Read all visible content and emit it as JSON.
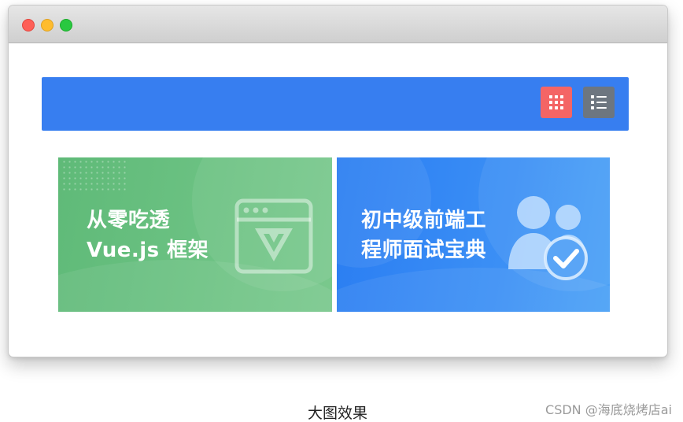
{
  "window": {
    "controls": [
      "close",
      "minimize",
      "zoom"
    ]
  },
  "toolbar": {
    "background": "#377ef0",
    "buttons": [
      {
        "name": "grid-view",
        "icon": "grid-icon",
        "color": "#f46565",
        "active": true
      },
      {
        "name": "list-view",
        "icon": "list-icon",
        "color": "#6d7680",
        "active": false
      }
    ]
  },
  "cards": [
    {
      "lines": [
        "从零吃透",
        "Vue.js 框架"
      ],
      "icon": "vue-window-icon",
      "color": "#66bf7f"
    },
    {
      "lines": [
        "初中级前端工",
        "程师面试宝典"
      ],
      "icon": "users-check-icon",
      "color": "#3487f3"
    }
  ],
  "caption": "大图效果",
  "watermark": "CSDN @海底烧烤店ai"
}
